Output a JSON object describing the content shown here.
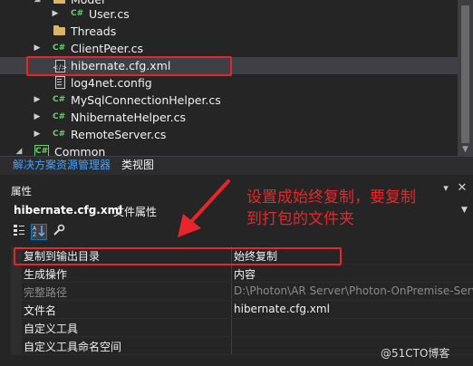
{
  "tree": {
    "items": [
      {
        "label": "Model",
        "icon": "folder-icon",
        "expander": "open-triangle",
        "indent": 2,
        "partial": true
      },
      {
        "label": "User.cs",
        "icon": "csharp-file-icon",
        "expander": "closed-triangle",
        "indent": 3
      },
      {
        "label": "Threads",
        "icon": "folder-icon",
        "expander": "",
        "indent": 2
      },
      {
        "label": "ClientPeer.cs",
        "icon": "csharp-file-icon",
        "expander": "closed-triangle",
        "indent": 2
      },
      {
        "label": "hibernate.cfg.xml",
        "icon": "xml-file-icon",
        "expander": "",
        "indent": 2,
        "selected": true
      },
      {
        "label": "log4net.config",
        "icon": "config-file-icon",
        "expander": "",
        "indent": 2
      },
      {
        "label": "MySqlConnectionHelper.cs",
        "icon": "csharp-file-icon",
        "expander": "closed-triangle",
        "indent": 2
      },
      {
        "label": "NhibernateHelper.cs",
        "icon": "csharp-file-icon",
        "expander": "closed-triangle",
        "indent": 2
      },
      {
        "label": "RemoteServer.cs",
        "icon": "csharp-file-icon",
        "expander": "closed-triangle",
        "indent": 2
      },
      {
        "label": "Common",
        "icon": "csharp-project-icon",
        "expander": "open-triangle",
        "indent": 1,
        "partial": true
      }
    ],
    "csharp_badge": "C#"
  },
  "tabs": {
    "solution_explorer": "解决方案资源管理器",
    "class_view": "类视图"
  },
  "properties": {
    "title": "属性",
    "object_name": "hibernate.cfg.xml",
    "object_type": "文件属性",
    "toolbar": [
      {
        "icon": "categorized-icon",
        "active": false
      },
      {
        "icon": "alphabetical-icon",
        "active": true
      },
      {
        "icon": "property-pages-wrench-icon",
        "active": false
      }
    ],
    "rows": [
      {
        "name": "复制到输出目录",
        "value": "始终复制",
        "highlight": true
      },
      {
        "name": "生成操作",
        "value": "内容"
      },
      {
        "name": "完整路径",
        "value": "D:\\Photon\\AR Server\\Photon-OnPremise-Serv",
        "disabled": true
      },
      {
        "name": "文件名",
        "value": "hibernate.cfg.xml"
      },
      {
        "name": "自定义工具",
        "value": ""
      },
      {
        "name": "自定义工具命名空间",
        "value": ""
      }
    ]
  },
  "annotation": {
    "note_line1": "设置成始终复制，要复制",
    "note_line2": "到打包的文件夹",
    "color": "#e8262a"
  },
  "watermark": "@51CTO博客"
}
